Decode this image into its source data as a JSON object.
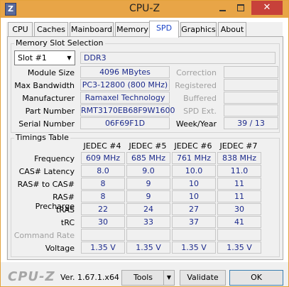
{
  "window": {
    "title": "CPU-Z",
    "app_icon": "Z",
    "close_glyph": "✕"
  },
  "tabs": [
    "CPU",
    "Caches",
    "Mainboard",
    "Memory",
    "SPD",
    "Graphics",
    "About"
  ],
  "slot_section": {
    "title": "Memory Slot Selection",
    "slot_value": "Slot #1",
    "type_value": "DDR3",
    "rows": [
      {
        "label": "Module Size",
        "value": "4096 MBytes"
      },
      {
        "label": "Max Bandwidth",
        "value": "PC3-12800 (800 MHz)"
      },
      {
        "label": "Manufacturer",
        "value": "Ramaxel Technology"
      },
      {
        "label": "Part Number",
        "value": "RMT3170EB68F9W1600"
      },
      {
        "label": "Serial Number",
        "value": "06F69F1D"
      }
    ],
    "right_labels": [
      "Correction",
      "Registered",
      "Buffered",
      "SPD Ext."
    ],
    "week_year_label": "Week/Year",
    "week_year_value": "39 / 13"
  },
  "timings": {
    "title": "Timings Table",
    "columns": [
      "JEDEC #4",
      "JEDEC #5",
      "JEDEC #6",
      "JEDEC #7"
    ],
    "rows": [
      {
        "label": "Frequency",
        "values": [
          "609 MHz",
          "685 MHz",
          "761 MHz",
          "838 MHz"
        ]
      },
      {
        "label": "CAS# Latency",
        "values": [
          "8.0",
          "9.0",
          "10.0",
          "11.0"
        ]
      },
      {
        "label": "RAS# to CAS#",
        "values": [
          "8",
          "9",
          "10",
          "11"
        ]
      },
      {
        "label": "RAS# Precharge",
        "values": [
          "8",
          "9",
          "10",
          "11"
        ]
      },
      {
        "label": "tRAS",
        "values": [
          "22",
          "24",
          "27",
          "30"
        ]
      },
      {
        "label": "tRC",
        "values": [
          "30",
          "33",
          "37",
          "41"
        ]
      },
      {
        "label": "Command Rate",
        "values": [
          "",
          "",
          "",
          ""
        ]
      },
      {
        "label": "Voltage",
        "values": [
          "1.35 V",
          "1.35 V",
          "1.35 V",
          "1.35 V"
        ]
      }
    ]
  },
  "footer": {
    "brand": "CPU-Z",
    "version": "Ver. 1.67.1.x64",
    "tools_label": "Tools",
    "validate_label": "Validate",
    "ok_label": "OK"
  }
}
